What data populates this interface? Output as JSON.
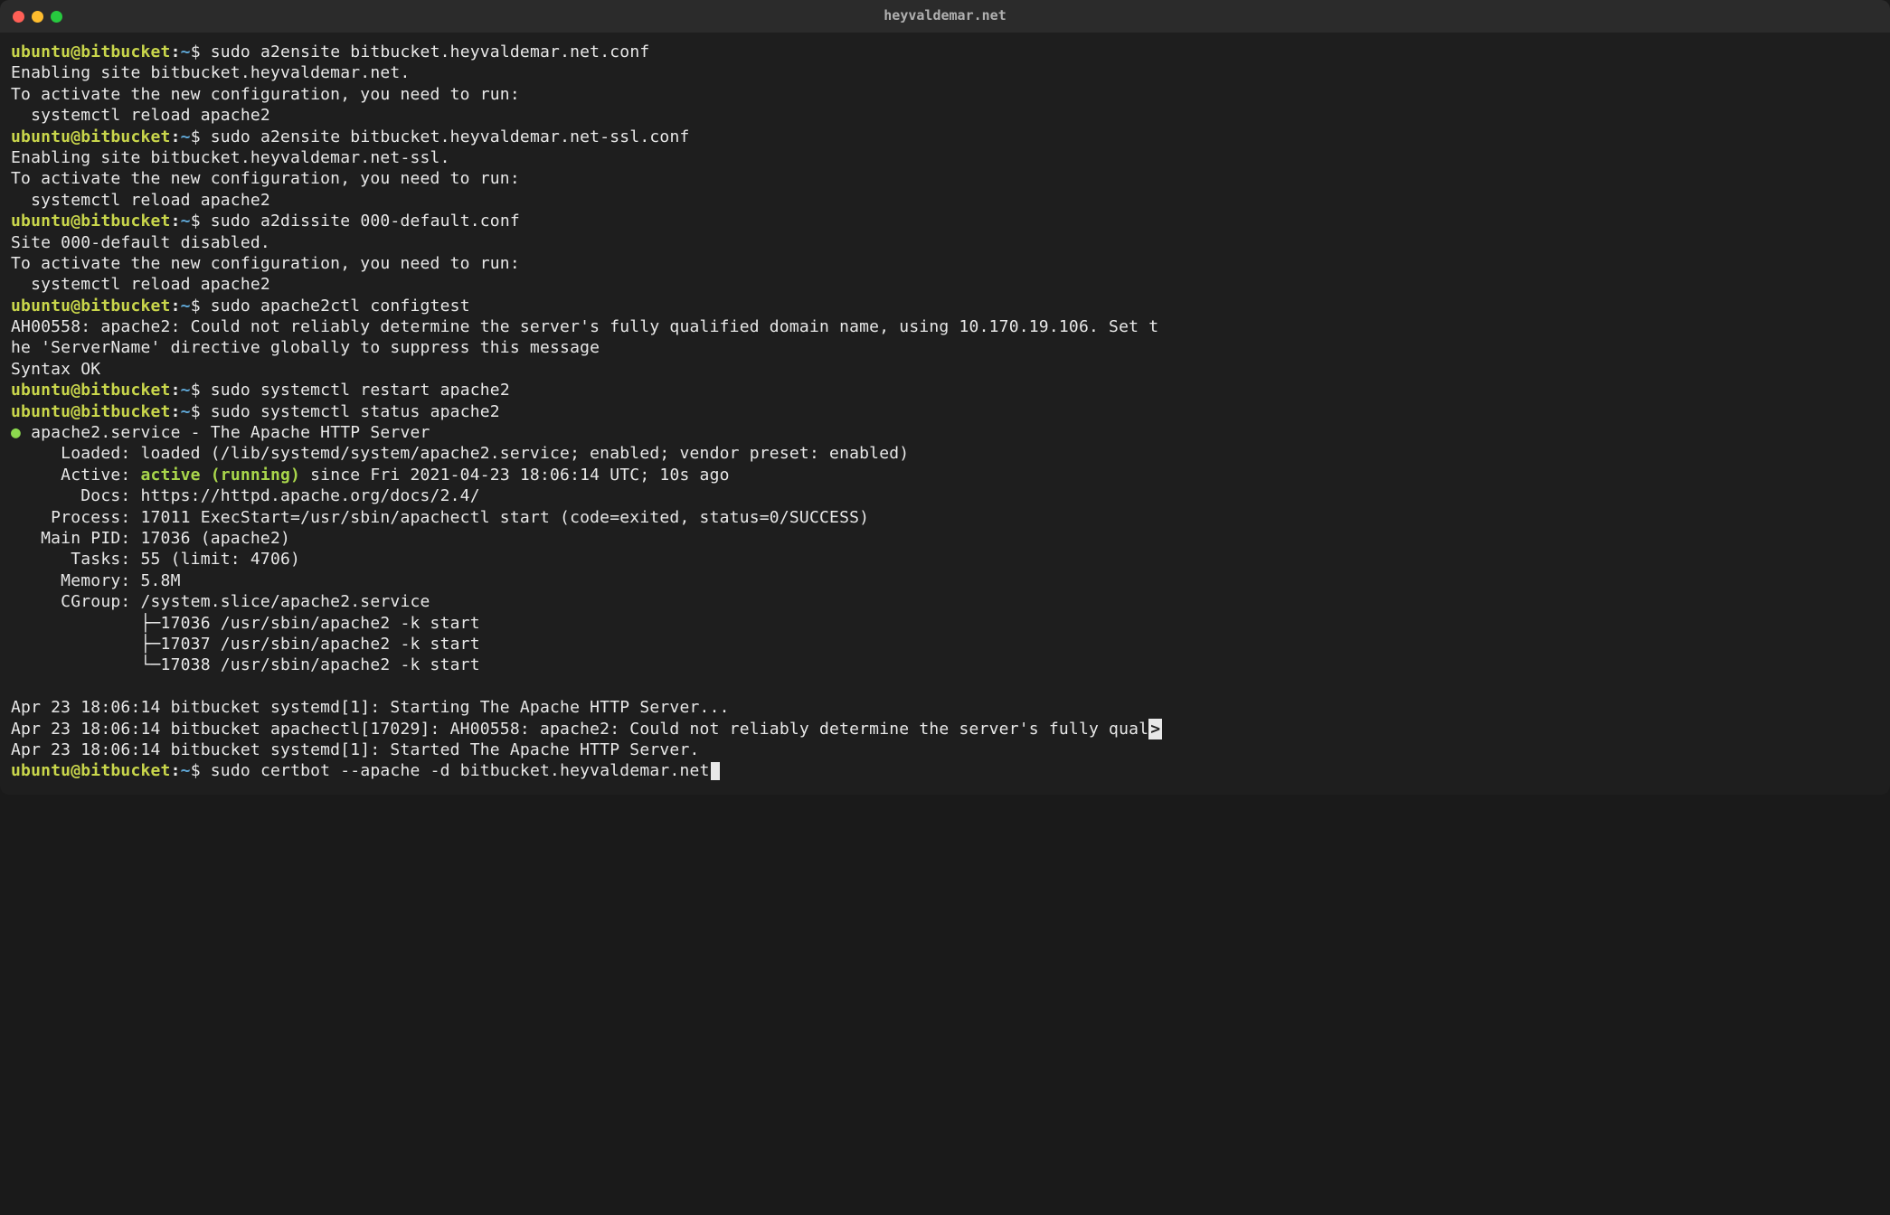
{
  "window": {
    "title": "heyvaldemar.net"
  },
  "prompt": {
    "user_host": "ubuntu@bitbucket",
    "sep1": ":",
    "tilde": "~",
    "dollar": "$"
  },
  "blocks": [
    {
      "cmd": " sudo a2ensite bitbucket.heyvaldemar.net.conf",
      "out": "Enabling site bitbucket.heyvaldemar.net.\nTo activate the new configuration, you need to run:\n  systemctl reload apache2"
    },
    {
      "cmd": " sudo a2ensite bitbucket.heyvaldemar.net-ssl.conf",
      "out": "Enabling site bitbucket.heyvaldemar.net-ssl.\nTo activate the new configuration, you need to run:\n  systemctl reload apache2"
    },
    {
      "cmd": " sudo a2dissite 000-default.conf",
      "out": "Site 000-default disabled.\nTo activate the new configuration, you need to run:\n  systemctl reload apache2"
    },
    {
      "cmd": " sudo apache2ctl configtest",
      "out": "AH00558: apache2: Could not reliably determine the server's fully qualified domain name, using 10.170.19.106. Set t\nhe 'ServerName' directive globally to suppress this message\nSyntax OK"
    },
    {
      "cmd": " sudo systemctl restart apache2",
      "out": ""
    }
  ],
  "status": {
    "cmd": " sudo systemctl status apache2",
    "bullet": "●",
    "header": " apache2.service - The Apache HTTP Server",
    "loaded": "     Loaded: loaded (/lib/systemd/system/apache2.service; enabled; vendor preset: enabled)",
    "active_label": "     Active: ",
    "active_value": "active (running)",
    "active_since": " since Fri 2021-04-23 18:06:14 UTC; 10s ago",
    "docs": "       Docs: https://httpd.apache.org/docs/2.4/",
    "process": "    Process: 17011 ExecStart=/usr/sbin/apachectl start (code=exited, status=0/SUCCESS)",
    "mainpid": "   Main PID: 17036 (apache2)",
    "tasks": "      Tasks: 55 (limit: 4706)",
    "memory": "     Memory: 5.8M",
    "cgroup0": "     CGroup: /system.slice/apache2.service",
    "cgroup1": "             ├─17036 /usr/sbin/apache2 -k start",
    "cgroup2": "             ├─17037 /usr/sbin/apache2 -k start",
    "cgroup3": "             └─17038 /usr/sbin/apache2 -k start",
    "log1": "Apr 23 18:06:14 bitbucket systemd[1]: Starting The Apache HTTP Server...",
    "log2a": "Apr 23 18:06:14 bitbucket apachectl[17029]: AH00558: apache2: Could not reliably determine the server's fully qual",
    "log2b": ">",
    "log3": "Apr 23 18:06:14 bitbucket systemd[1]: Started The Apache HTTP Server."
  },
  "final_cmd": " sudo certbot --apache -d bitbucket.heyvaldemar.net"
}
